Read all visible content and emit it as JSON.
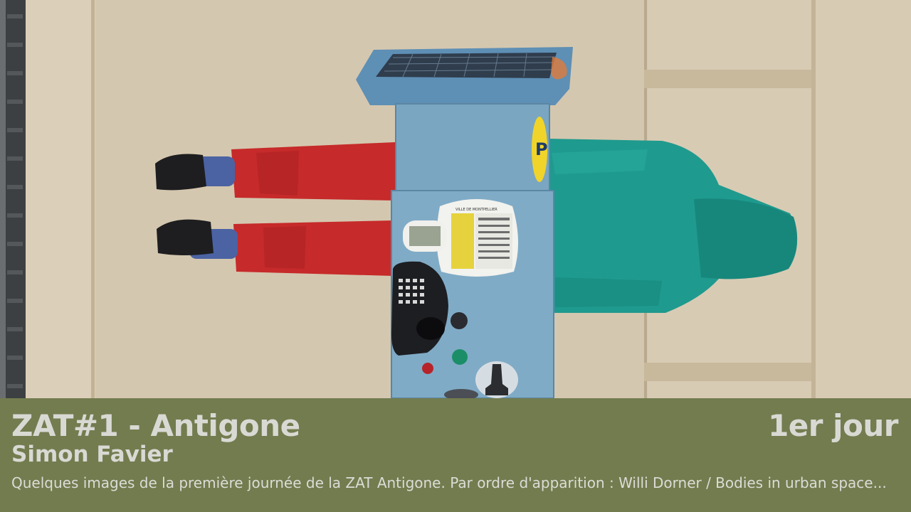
{
  "video": {
    "title": "ZAT#1 - Antigone",
    "author": "Simon Favier",
    "day": "1er jour",
    "description": "Quelques images de la première journée de la ZAT Antigone. Par ordre d'apparition : Willi Dorner / Bodies in urban space..."
  },
  "colors": {
    "info_bar_bg": "#727c4f",
    "text": "#d9d9d4",
    "wall": "#d8cbb4",
    "meter": "#7aa6c2",
    "hoodie": "#1f9a8e",
    "pants": "#c62a2a"
  },
  "photo": {
    "meter_sign": "P",
    "meter_panel_heading": "VILLE DE MONTPELLIER"
  }
}
